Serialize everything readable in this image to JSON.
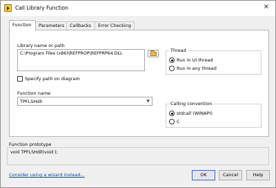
{
  "window": {
    "title": "Call Library Function",
    "close_glyph": "✕",
    "icon": "labview-vi-icon"
  },
  "tabs": [
    {
      "label": "Function",
      "active": true
    },
    {
      "label": "Parameters",
      "active": false
    },
    {
      "label": "Callbacks",
      "active": false
    },
    {
      "label": "Error Checking",
      "active": false
    }
  ],
  "function_tab": {
    "library_label": "Library name or path",
    "library_value": "C:\\Program Files (x86)\\REFPROP\\REFPRP64.DLL",
    "specify_path_label": "Specify path on diagram",
    "specify_path_checked": false,
    "function_name_label": "Function name",
    "function_name_value": "TPFLSHdll",
    "thread": {
      "title": "Thread",
      "options": [
        "Run in UI thread",
        "Run in any thread"
      ],
      "selected": "Run in UI thread"
    },
    "calling_convention": {
      "title": "Calling convention",
      "options": [
        "stdcall (WINAPI)",
        "C"
      ],
      "selected": "stdcall (WINAPI)"
    }
  },
  "prototype": {
    "label": "Function prototype",
    "value": "void  TPFLSHdll(void );"
  },
  "footer": {
    "wizard_link": "Consider using a wizard instead...",
    "ok": "OK",
    "cancel": "Cancel",
    "help": "Help"
  }
}
